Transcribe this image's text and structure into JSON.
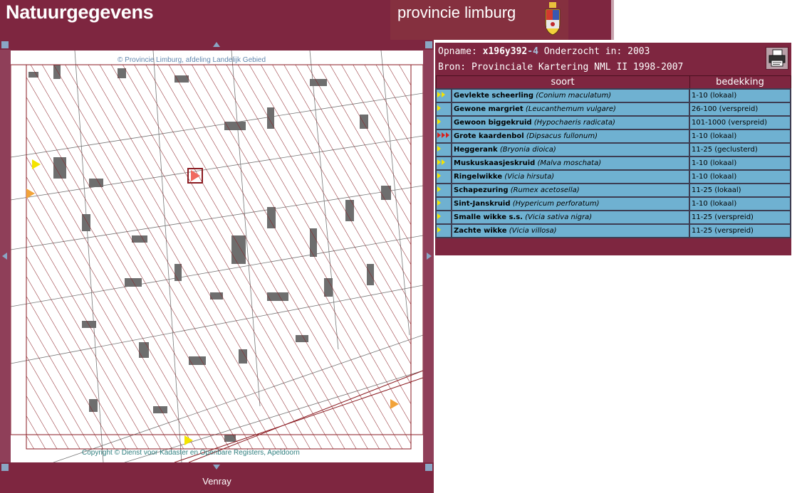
{
  "header": {
    "title": "Natuurgegevens",
    "province": "provincie limburg",
    "colors": {
      "bar": "#7e2640",
      "province_bg": "#85303f"
    }
  },
  "map": {
    "credit_top": "© Provincie Limburg, afdeling Landelijk Gebied",
    "credit_bottom": "Copyright © Dienst voor Kadaster en Openbare Registers,  Apeldoorn",
    "place_name": "Venray",
    "icons": [
      "pan-up-icon",
      "pan-down-icon",
      "pan-left-icon",
      "pan-right-icon",
      "zoom-corner-icon"
    ]
  },
  "record": {
    "opname_label": "Opname:",
    "opname_code": "x196y392",
    "opname_suffix": "-4",
    "onderzocht_label": "Onderzocht in:",
    "onderzocht_year": "2003",
    "bron_text": "Bron: Provinciale Kartering NML II 1998-2007",
    "print_icon": "printer-icon"
  },
  "table": {
    "headers": [
      "soort",
      "bedekking"
    ],
    "rows": [
      {
        "marks": "yy",
        "name": "Gevlekte scheerling",
        "latin": "(Conium maculatum)",
        "cover": "1-10 (lokaal)"
      },
      {
        "marks": "y",
        "name": "Gewone margriet",
        "latin": "(Leucanthemum vulgare)",
        "cover": "26-100 (verspreid)"
      },
      {
        "marks": "y",
        "name": "Gewoon biggekruid",
        "latin": "(Hypochaeris radicata)",
        "cover": "101-1000 (verspreid)"
      },
      {
        "marks": "rrr",
        "name": "Grote kaardenbol",
        "latin": "(Dipsacus fullonum)",
        "cover": "1-10 (lokaal)"
      },
      {
        "marks": "y",
        "name": "Heggerank",
        "latin": "(Bryonia dioica)",
        "cover": "11-25 (geclusterd)"
      },
      {
        "marks": "yy",
        "name": "Muskuskaasjeskruid",
        "latin": "(Malva moschata)",
        "cover": "1-10 (lokaal)"
      },
      {
        "marks": "y",
        "name": "Ringelwikke",
        "latin": "(Vicia hirsuta)",
        "cover": "1-10 (lokaal)"
      },
      {
        "marks": "y",
        "name": "Schapezuring",
        "latin": "(Rumex acetosella)",
        "cover": "11-25 (lokaal)"
      },
      {
        "marks": "y",
        "name": "Sint-Janskruid",
        "latin": "(Hypericum perforatum)",
        "cover": "1-10 (lokaal)"
      },
      {
        "marks": "y",
        "name": "Smalle wikke s.s.",
        "latin": "(Vicia sativa nigra)",
        "cover": "11-25 (verspreid)"
      },
      {
        "marks": "y",
        "name": "Zachte wikke",
        "latin": "(Vicia villosa)",
        "cover": "11-25 (verspreid)"
      }
    ],
    "colors": {
      "row_bg": "#6fb1d1",
      "mark_yellow": "#f4e400",
      "mark_red": "#d6221f"
    }
  }
}
